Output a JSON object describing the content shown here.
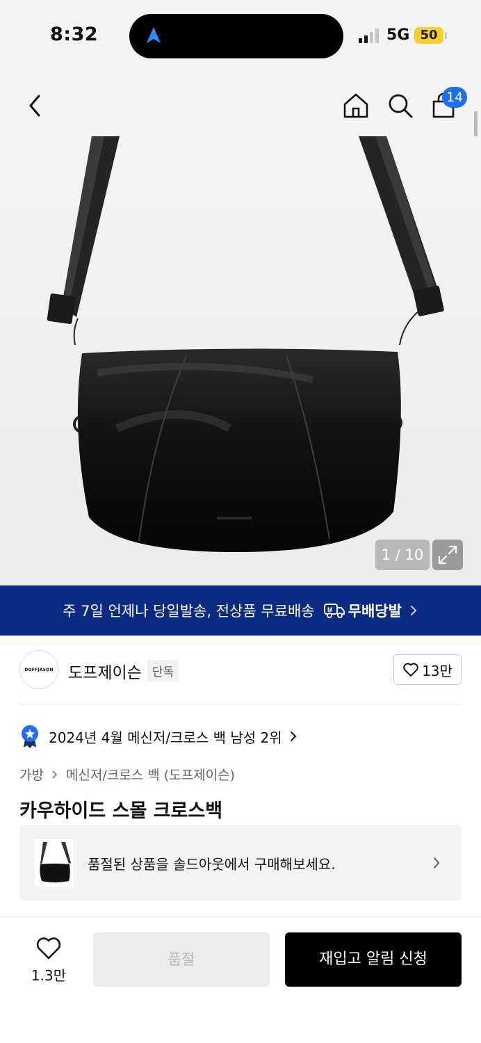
{
  "status_bar": {
    "time": "8:32",
    "network": "5G",
    "battery": "50"
  },
  "nav": {
    "cart_count": "14"
  },
  "gallery": {
    "counter": "1 / 10"
  },
  "delivery_banner": {
    "text": "주 7일 언제나 당일발송, 전상품 무료배송",
    "brand": "무배당발"
  },
  "brand": {
    "logo_text": "DOFFJASON",
    "name": "도프제이슨",
    "tag": "단독",
    "likes": "13만"
  },
  "ranking": {
    "text": "2024년 4월 메신저/크로스 백 남성 2위"
  },
  "breadcrumb": {
    "level1": "가방",
    "level2": "메신저/크로스 백 (도프제이슨)"
  },
  "product": {
    "title": "카우하이드 스몰 크로스백"
  },
  "soldout_card": {
    "text": "품절된 상품을 솔드아웃에서 구매해보세요."
  },
  "bottom_bar": {
    "wish_count": "1.3만",
    "soldout_label": "품절",
    "restock_label": "재입고 알림 신청"
  },
  "colors": {
    "accent_blue": "#1c6ef2",
    "banner_navy": "#0b2a84",
    "battery_yellow": "#f7cf2b"
  }
}
